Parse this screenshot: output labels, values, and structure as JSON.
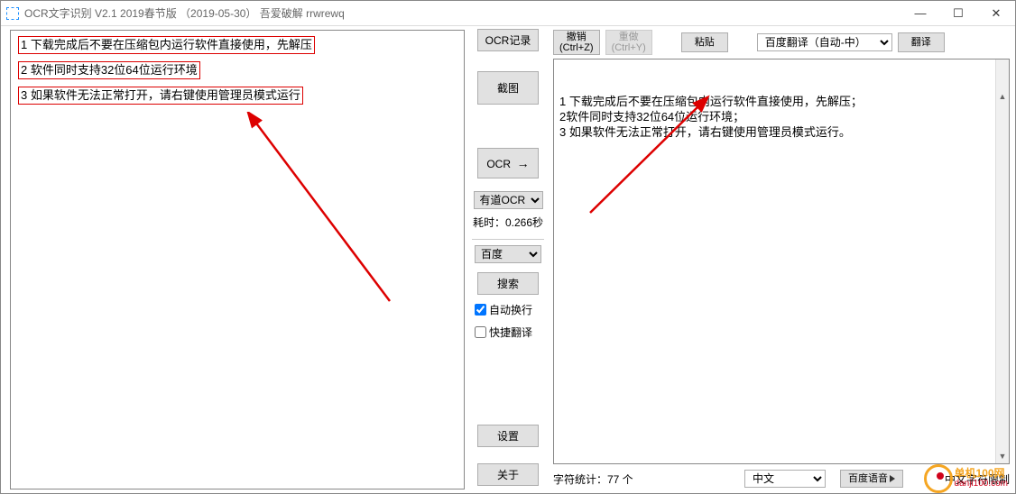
{
  "title": "OCR文字识别 V2.1   2019春节版  （2019-05-30）   吾爱破解 rrwrewq",
  "left": {
    "l1": "1 下载完成后不要在压缩包内运行软件直接使用，先解压",
    "l2": "2 软件同时支持32位64位运行环境",
    "l3": "3 如果软件无法正常打开，请右键使用管理员模式运行"
  },
  "mid": {
    "record": "OCR记录",
    "screenshot": "截图",
    "ocr": "OCR",
    "ocrEngineSelect": "有道OCR",
    "timing": "耗时：0.266秒",
    "engine2": "百度",
    "search": "搜索",
    "autowrap": "自动换行",
    "quicktrans": "快捷翻译",
    "settings": "设置",
    "about": "关于"
  },
  "top": {
    "undo": "撤销\n(Ctrl+Z)",
    "redo": "重做\n(Ctrl+Y)",
    "paste": "粘贴",
    "transSelect": "百度翻译（自动-中）",
    "translate": "翻译"
  },
  "output": "1 下载完成后不要在压缩包内运行软件直接使用，先解压；\n2软件同时支持32位64位运行环境；\n3 如果软件无法正常打开，请右键使用管理员模式运行。",
  "bottom": {
    "charcount": "字符统计：77 个",
    "langSelect": "中文",
    "voiceBtn": "百度语音",
    "limit": "中文字符限制"
  },
  "watermark": {
    "name": "单机100网",
    "url": "danji100.com"
  }
}
